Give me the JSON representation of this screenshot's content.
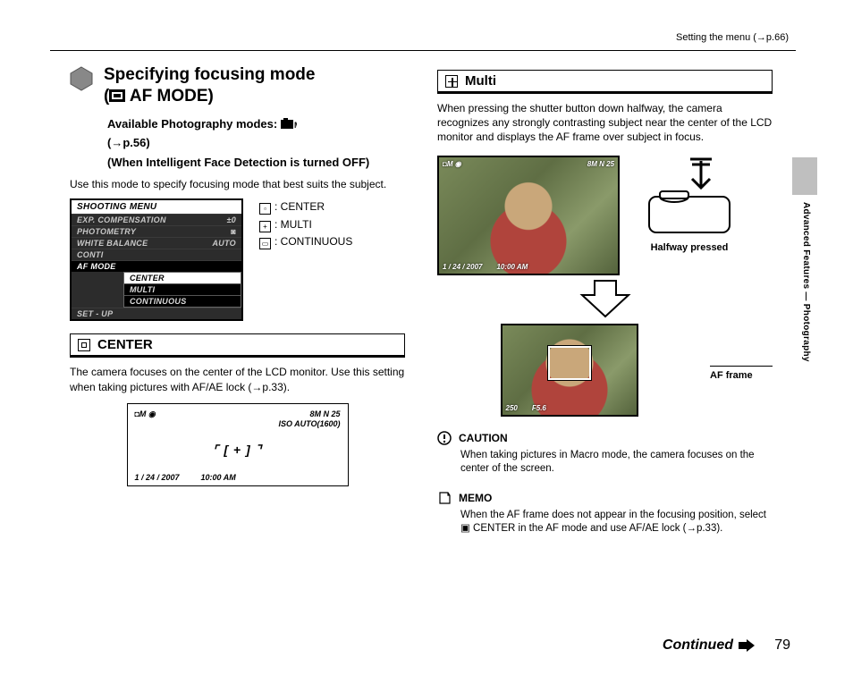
{
  "topRef": "Setting the menu (→p.66)",
  "sideText": "Advanced Features — Photography",
  "head": {
    "title_l1": "Specifying focusing mode",
    "title_l2": "(",
    "title_l2b": " AF MODE)",
    "sub1": "Available Photography modes: ",
    "sub1b": "(→p.56)",
    "sub2": "(When Intelligent Face Detection is turned OFF)"
  },
  "intro": "Use this mode to specify focusing mode that best suits the subject.",
  "menu": {
    "title": "SHOOTING MENU",
    "rows": [
      {
        "l": "EXP. COMPENSATION",
        "r": "±0"
      },
      {
        "l": "PHOTOMETRY",
        "r": "◙"
      },
      {
        "l": "WHITE BALANCE",
        "r": "AUTO"
      },
      {
        "l": "CONTI",
        "r": ""
      },
      {
        "l": "AF MODE",
        "r": "",
        "sel": true
      },
      {
        "l": "SET - UP",
        "r": ""
      }
    ],
    "sub": [
      "CENTER",
      "MULTI",
      "CONTINUOUS"
    ]
  },
  "legend": {
    "a": ": CENTER",
    "b": ": MULTI",
    "c": ": CONTINUOUS"
  },
  "center": {
    "title": "CENTER",
    "body": "The camera focuses on the center of the LCD monitor. Use this setting when taking pictures with AF/AE lock (→p.33).",
    "lcd": {
      "tl": "◘M ◉",
      "tr": "8M  N   25",
      "iso": "ISO AUTO(1600)",
      "date": "1 / 24 / 2007",
      "time": "10:00 AM"
    }
  },
  "multi": {
    "title": "Multi",
    "body": "When pressing the shutter button down halfway, the camera recognizes any strongly contrasting subject near the center of the LCD monitor and displays the AF frame over subject in focus.",
    "photo1": {
      "tl": "◘M ◉",
      "tr": "8M N  25",
      "bl": "1 / 24 / 2007",
      "br": "10:00 AM"
    },
    "halfway": "Halfway pressed",
    "photo2": {
      "bl": "250",
      "br": "F5.6"
    },
    "afFrame": "AF frame"
  },
  "caution": {
    "title": "CAUTION",
    "body": "When taking pictures in Macro mode, the camera focuses on the center of the screen."
  },
  "memo": {
    "title": "MEMO",
    "body": "When the AF frame does not appear in the focusing position, select ▣ CENTER in the AF mode and use AF/AE lock (→p.33)."
  },
  "continued": "Continued",
  "pageNum": "79"
}
